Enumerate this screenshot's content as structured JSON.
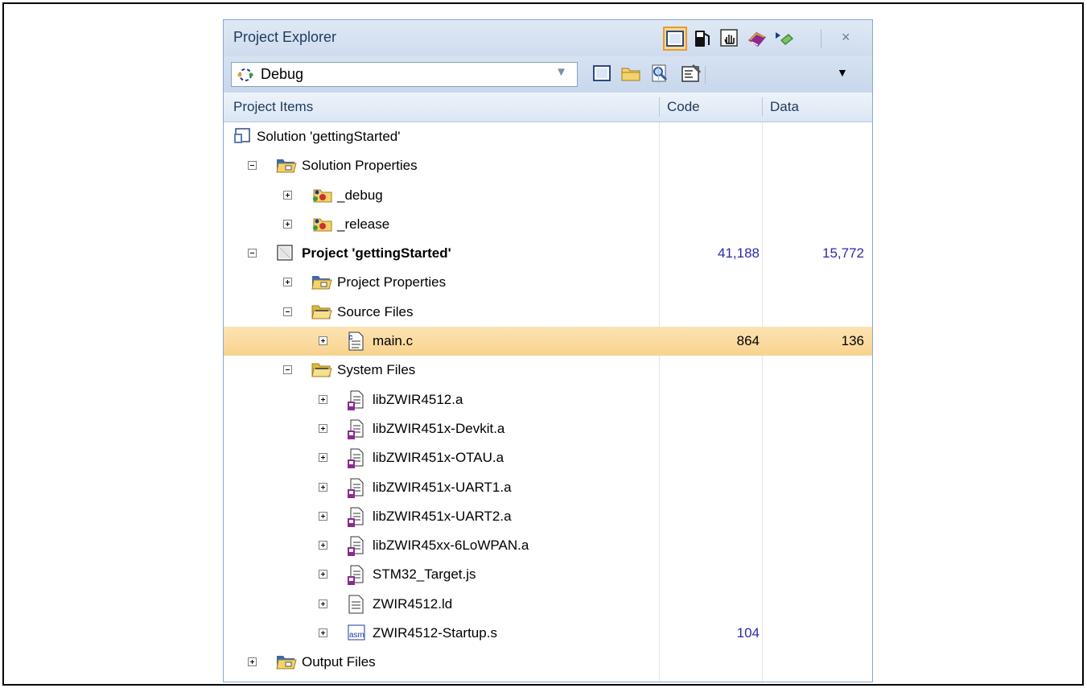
{
  "panel": {
    "title": "Project Explorer",
    "close_label": "×",
    "toolbar_icons": [
      "project-view-icon",
      "fuel-icon",
      "hand-icon",
      "book-icon",
      "chip-icon"
    ]
  },
  "config": {
    "selected": "Debug",
    "icon": "config-cycle-icon"
  },
  "columns": {
    "items": "Project Items",
    "code": "Code",
    "data": "Data"
  },
  "tree": [
    {
      "label": "Solution 'gettingStarted'",
      "icon": "solution-icon",
      "level": 0,
      "expander": "none",
      "bold": false,
      "code": "",
      "data": ""
    },
    {
      "label": "Solution Properties",
      "icon": "properties-folder-icon",
      "level": 1,
      "expander": "minus",
      "bold": false,
      "code": "",
      "data": ""
    },
    {
      "label": "_debug",
      "icon": "config-folder-icon",
      "level": 2,
      "expander": "plus",
      "bold": false,
      "code": "",
      "data": ""
    },
    {
      "label": "_release",
      "icon": "config-folder-icon",
      "level": 2,
      "expander": "plus",
      "bold": false,
      "code": "",
      "data": ""
    },
    {
      "label": "Project 'gettingStarted'",
      "icon": "project-icon",
      "level": 1,
      "expander": "minus",
      "bold": true,
      "code": "41,188",
      "data": "15,772"
    },
    {
      "label": "Project Properties",
      "icon": "properties-folder-icon",
      "level": 2,
      "expander": "plus",
      "bold": false,
      "code": "",
      "data": ""
    },
    {
      "label": "Source Files",
      "icon": "folder-open-icon",
      "level": 2,
      "expander": "minus",
      "bold": false,
      "code": "",
      "data": ""
    },
    {
      "label": "main.c",
      "icon": "c-file-icon",
      "level": 3,
      "expander": "plus",
      "bold": false,
      "code": "864",
      "data": "136",
      "selected": true
    },
    {
      "label": "System Files",
      "icon": "folder-open-icon",
      "level": 2,
      "expander": "minus",
      "bold": false,
      "code": "",
      "data": ""
    },
    {
      "label": "libZWIR4512.a",
      "icon": "library-file-icon",
      "level": 3,
      "expander": "plus",
      "bold": false,
      "code": "",
      "data": ""
    },
    {
      "label": "libZWIR451x-Devkit.a",
      "icon": "library-file-icon",
      "level": 3,
      "expander": "plus",
      "bold": false,
      "code": "",
      "data": ""
    },
    {
      "label": "libZWIR451x-OTAU.a",
      "icon": "library-file-icon",
      "level": 3,
      "expander": "plus",
      "bold": false,
      "code": "",
      "data": ""
    },
    {
      "label": "libZWIR451x-UART1.a",
      "icon": "library-file-icon",
      "level": 3,
      "expander": "plus",
      "bold": false,
      "code": "",
      "data": ""
    },
    {
      "label": "libZWIR451x-UART2.a",
      "icon": "library-file-icon",
      "level": 3,
      "expander": "plus",
      "bold": false,
      "code": "",
      "data": ""
    },
    {
      "label": "libZWIR45xx-6LoWPAN.a",
      "icon": "library-file-icon",
      "level": 3,
      "expander": "plus",
      "bold": false,
      "code": "",
      "data": ""
    },
    {
      "label": "STM32_Target.js",
      "icon": "library-file-icon",
      "level": 3,
      "expander": "plus",
      "bold": false,
      "code": "",
      "data": ""
    },
    {
      "label": "ZWIR4512.ld",
      "icon": "text-file-icon",
      "level": 3,
      "expander": "plus",
      "bold": false,
      "code": "",
      "data": ""
    },
    {
      "label": "ZWIR4512-Startup.s",
      "icon": "asm-file-icon",
      "level": 3,
      "expander": "plus",
      "bold": false,
      "code": "104",
      "data": ""
    },
    {
      "label": "Output Files",
      "icon": "properties-folder-icon",
      "level": 1,
      "expander": "plus",
      "bold": false,
      "code": "",
      "data": ""
    }
  ],
  "colors": {
    "accent": "#e59a3a",
    "selection": "#f8d38f",
    "number": "#2a2aa8",
    "title": "#1e395b"
  }
}
